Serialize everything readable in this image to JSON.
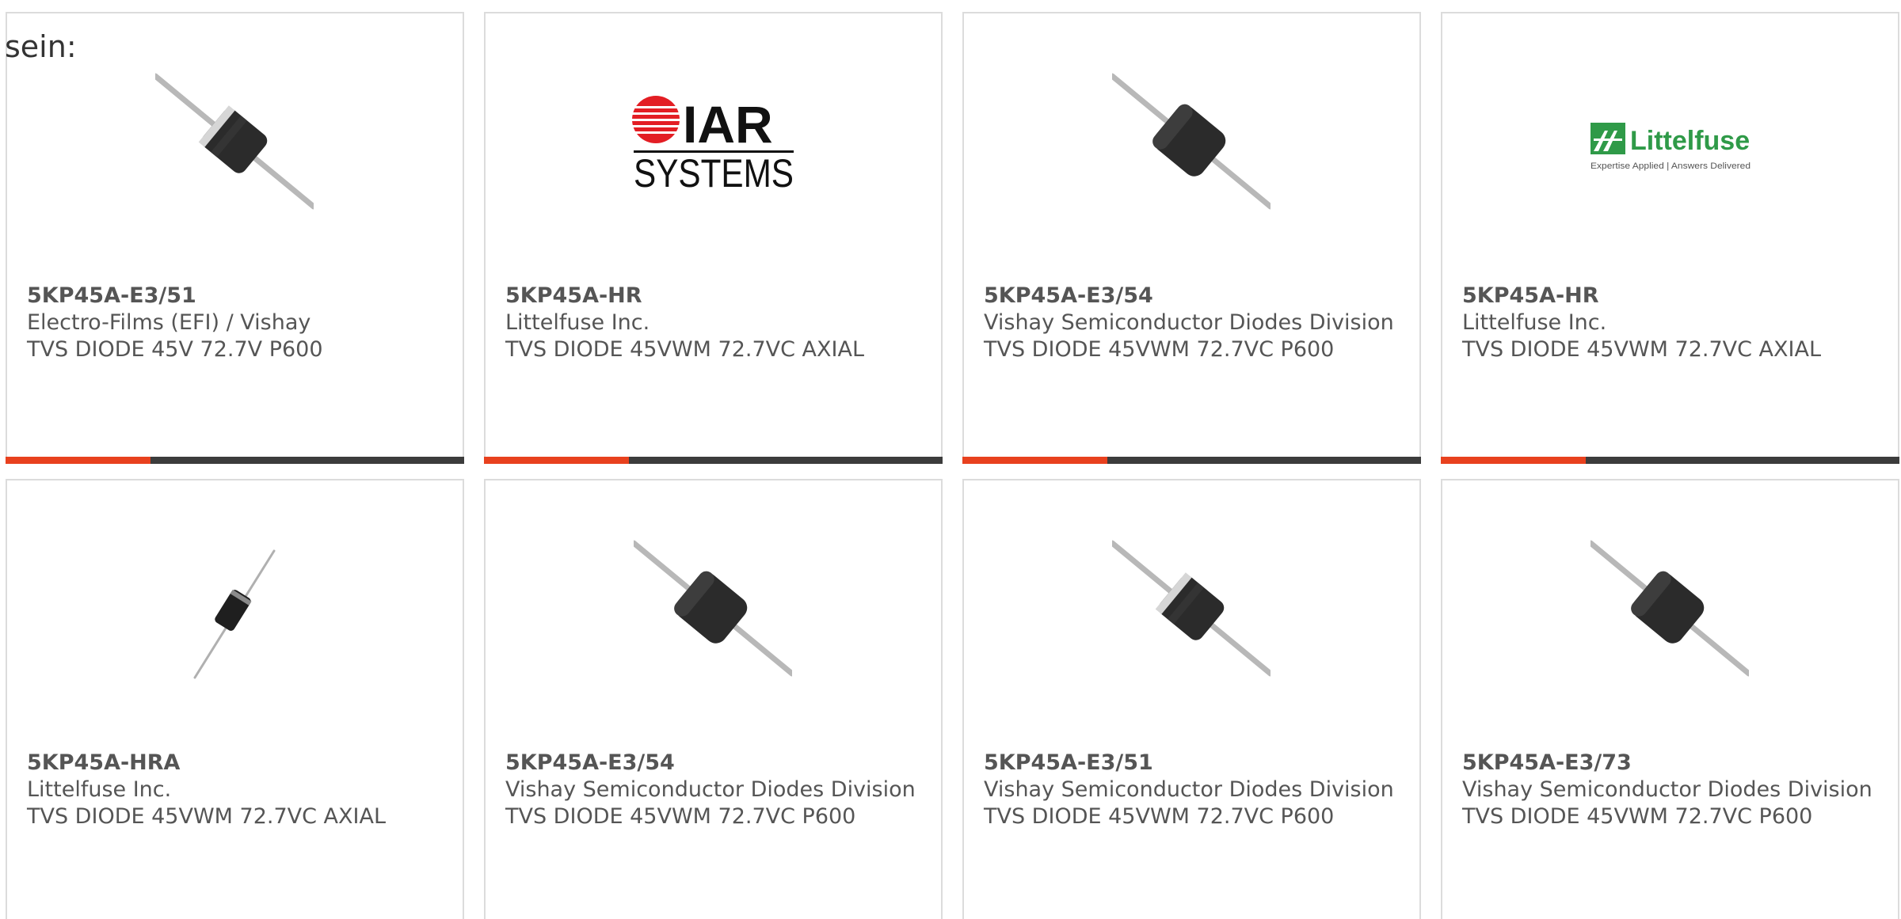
{
  "intro_text": "sein:",
  "products": [
    {
      "part": "5KP45A-E3/51",
      "manufacturer": "Electro-Films (EFI) / Vishay",
      "description": "TVS DIODE 45V 72.7V P600",
      "image_icon": "axial-diode-banded-icon"
    },
    {
      "part": "5KP45A-HR",
      "manufacturer": "Littelfuse Inc.",
      "description": "TVS DIODE 45VWM 72.7VC AXIAL",
      "image_icon": "iar-systems-logo",
      "logo_text": [
        "IAR",
        "SYSTEMS"
      ]
    },
    {
      "part": "5KP45A-E3/54",
      "manufacturer": "Vishay Semiconductor Diodes Division",
      "description": "TVS DIODE 45VWM 72.7VC P600",
      "image_icon": "axial-diode-icon"
    },
    {
      "part": "5KP45A-HR",
      "manufacturer": "Littelfuse Inc.",
      "description": "TVS DIODE 45VWM 72.7VC AXIAL",
      "image_icon": "littelfuse-logo",
      "logo_text": [
        "Littelfuse",
        "Expertise Applied | Answers Delivered"
      ]
    },
    {
      "part": "5KP45A-HRA",
      "manufacturer": "Littelfuse Inc.",
      "description": "TVS DIODE 45VWM 72.7VC AXIAL",
      "image_icon": "small-axial-diode-icon"
    },
    {
      "part": "5KP45A-E3/54",
      "manufacturer": "Vishay Semiconductor Diodes Division",
      "description": "TVS DIODE 45VWM 72.7VC P600",
      "image_icon": "axial-diode-icon"
    },
    {
      "part": "5KP45A-E3/51",
      "manufacturer": "Vishay Semiconductor Diodes Division",
      "description": "TVS DIODE 45VWM 72.7VC P600",
      "image_icon": "axial-diode-banded-icon"
    },
    {
      "part": "5KP45A-E3/73",
      "manufacturer": "Vishay Semiconductor Diodes Division",
      "description": "TVS DIODE 45VWM 72.7VC P600",
      "image_icon": "axial-diode-icon"
    }
  ],
  "colors": {
    "accent": "#e8411e",
    "bar": "#3c3c3c",
    "text": "#555555",
    "border": "#dcdcdc",
    "iar_red": "#e31e24",
    "littelfuse_green": "#2f9a48"
  }
}
